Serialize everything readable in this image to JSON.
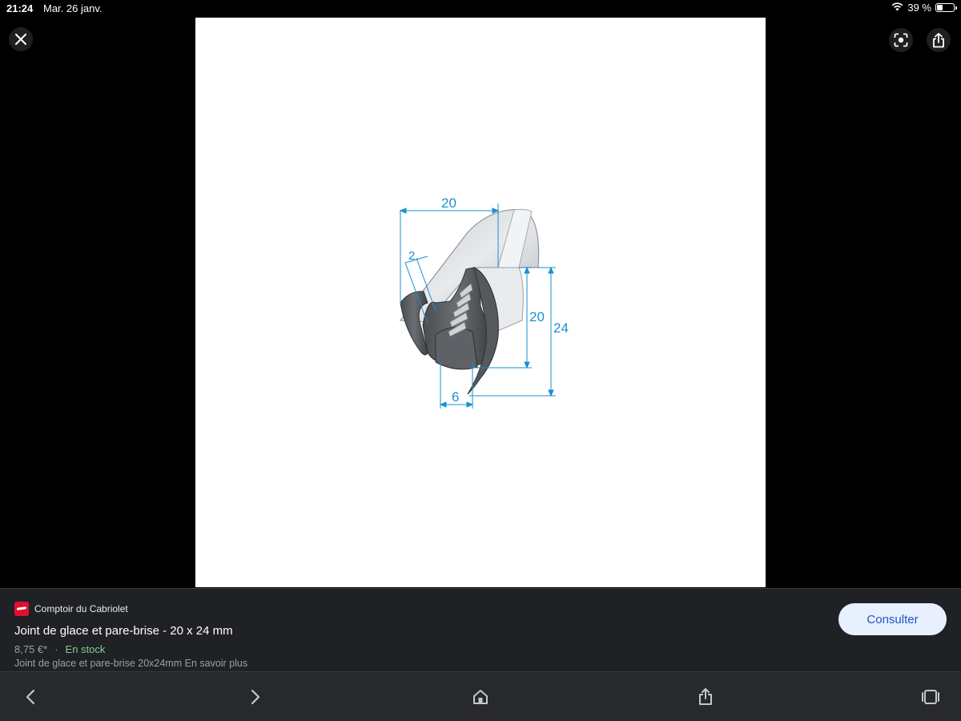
{
  "status_bar": {
    "time": "21:24",
    "date": "Mar. 26 janv.",
    "battery_text": "39 %",
    "battery_level": 0.39
  },
  "viewer": {
    "dimensions": {
      "top": "20",
      "thickness": "2",
      "inner": "20",
      "total": "24",
      "bottom": "6"
    },
    "icons": {
      "close": "close-icon",
      "lens": "lens-icon",
      "share": "share-icon"
    }
  },
  "result": {
    "source": "Comptoir du Cabriolet",
    "title": "Joint de glace et pare-brise - 20 x 24 mm",
    "price": "8,75 €*",
    "separator": "·",
    "stock": "En stock",
    "description": "Joint de glace et pare-brise 20x24mm En savoir plus",
    "action_label": "Consulter"
  },
  "toolbar": {
    "icons": [
      "back-icon",
      "forward-icon",
      "home-icon",
      "share-icon",
      "tabs-icon"
    ]
  },
  "colors": {
    "dimension_blue": "#1b8fd1",
    "stock_green": "#81c995",
    "button_bg": "#e8f0fe",
    "button_text": "#1a56c4",
    "favicon": "#e01032"
  }
}
